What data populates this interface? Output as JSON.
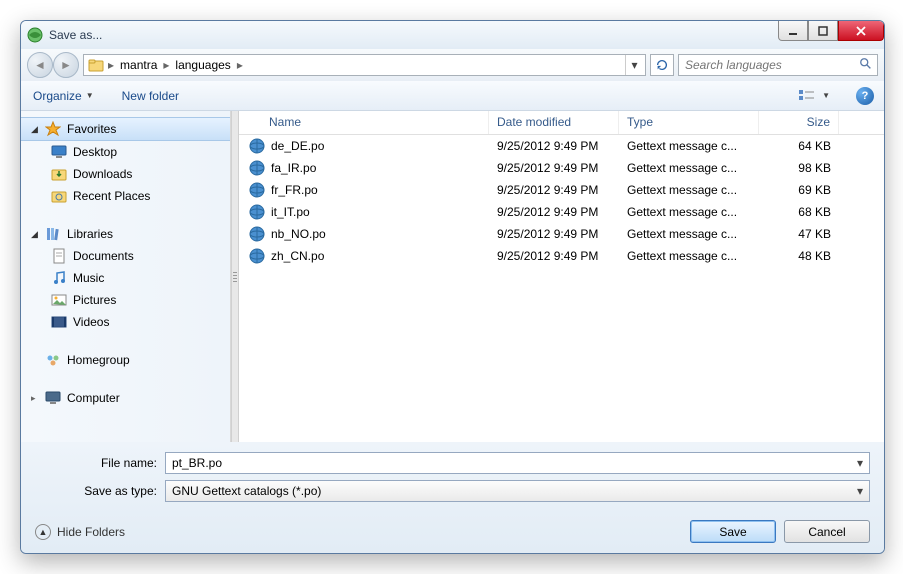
{
  "title": "Save as...",
  "breadcrumbs": [
    "mantra",
    "languages"
  ],
  "search_placeholder": "Search languages",
  "toolbar": {
    "organize": "Organize",
    "newfolder": "New folder"
  },
  "sidebar": {
    "favorites_label": "Favorites",
    "favorites": [
      "Desktop",
      "Downloads",
      "Recent Places"
    ],
    "libraries_label": "Libraries",
    "libraries": [
      "Documents",
      "Music",
      "Pictures",
      "Videos"
    ],
    "homegroup": "Homegroup",
    "computer": "Computer"
  },
  "columns": {
    "name": "Name",
    "date": "Date modified",
    "type": "Type",
    "size": "Size"
  },
  "files": [
    {
      "name": "de_DE.po",
      "date": "9/25/2012 9:49 PM",
      "type": "Gettext message c...",
      "size": "64 KB"
    },
    {
      "name": "fa_IR.po",
      "date": "9/25/2012 9:49 PM",
      "type": "Gettext message c...",
      "size": "98 KB"
    },
    {
      "name": "fr_FR.po",
      "date": "9/25/2012 9:49 PM",
      "type": "Gettext message c...",
      "size": "69 KB"
    },
    {
      "name": "it_IT.po",
      "date": "9/25/2012 9:49 PM",
      "type": "Gettext message c...",
      "size": "68 KB"
    },
    {
      "name": "nb_NO.po",
      "date": "9/25/2012 9:49 PM",
      "type": "Gettext message c...",
      "size": "47 KB"
    },
    {
      "name": "zh_CN.po",
      "date": "9/25/2012 9:49 PM",
      "type": "Gettext message c...",
      "size": "48 KB"
    }
  ],
  "form": {
    "filename_label": "File name:",
    "filename_value": "pt_BR.po",
    "type_label": "Save as type:",
    "type_value": "GNU Gettext catalogs (*.po)"
  },
  "buttons": {
    "hide": "Hide Folders",
    "save": "Save",
    "cancel": "Cancel"
  }
}
